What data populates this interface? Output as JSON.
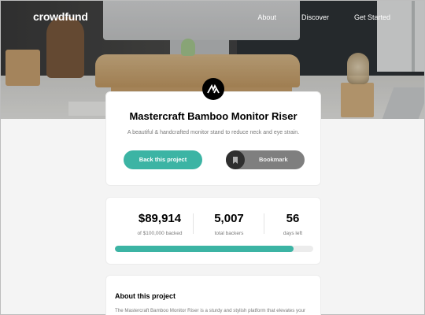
{
  "header": {
    "brand": "crowdfund",
    "nav": [
      {
        "label": "About"
      },
      {
        "label": "Discover"
      },
      {
        "label": "Get Started"
      }
    ]
  },
  "project": {
    "title": "Mastercraft Bamboo Monitor Riser",
    "description": "A beautiful & handcrafted monitor stand to reduce neck and eye strain.",
    "back_label": "Back this project",
    "bookmark_label": "Bookmark",
    "logo_icon": "mastercraft-logo-icon",
    "bookmark_icon": "bookmark-icon"
  },
  "stats": {
    "raised": "$89,914",
    "raised_label": "of $100,000 backed",
    "backers": "5,007",
    "backers_label": "total backers",
    "days": "56",
    "days_label": "days left",
    "progress_fraction": 0.8991
  },
  "about": {
    "title": "About this project",
    "text": "The Mastercraft Bamboo Monitor Riser is a sturdy and stylish platform that elevates your"
  },
  "colors": {
    "accent": "#3cb4a4",
    "dark_accent": "#2f2f2f",
    "page_background": "#f4f4f4"
  }
}
